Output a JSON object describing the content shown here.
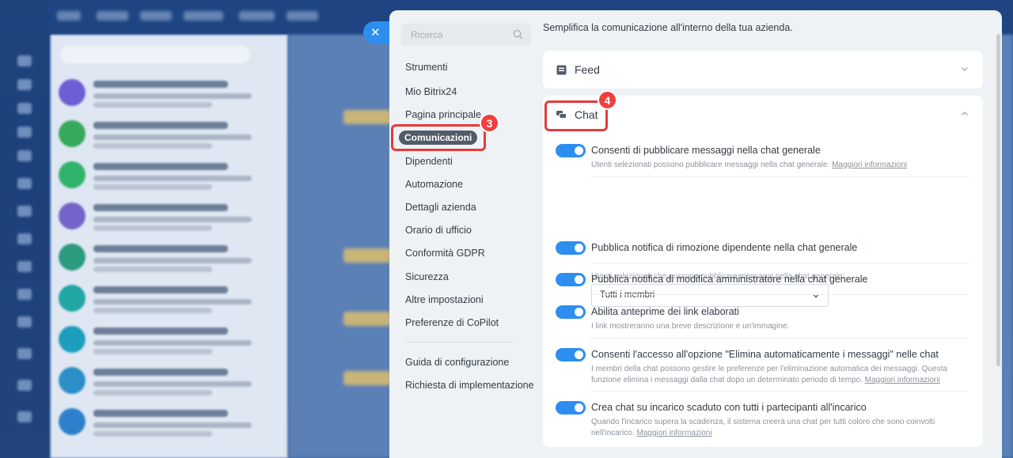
{
  "panel": {
    "search_placeholder": "Ricerca",
    "intro": "Semplifica la comunicazione all'interno della tua azienda."
  },
  "nav": {
    "items": [
      {
        "label": "Strumenti"
      },
      {
        "label": "Mio Bitrix24"
      },
      {
        "label": "Pagina principale"
      },
      {
        "label": "Comunicazioni",
        "active": true
      },
      {
        "label": "Dipendenti"
      },
      {
        "label": "Automazione"
      },
      {
        "label": "Dettagli azienda"
      },
      {
        "label": "Orario di ufficio"
      },
      {
        "label": "Conformità GDPR"
      },
      {
        "label": "Sicurezza"
      },
      {
        "label": "Altre impostazioni"
      },
      {
        "label": "Preferenze di CoPilot"
      }
    ],
    "footer": [
      {
        "label": "Guida di configurazione"
      },
      {
        "label": "Richiesta di implementazione"
      }
    ]
  },
  "badges": {
    "nav": "3",
    "chat": "4"
  },
  "sections": {
    "feed": {
      "title": "Feed",
      "expanded": false
    },
    "chat": {
      "title": "Chat",
      "expanded": true,
      "options": [
        {
          "title": "Consenti di pubblicare messaggi nella chat generale",
          "description": "Utenti selezionati possono pubblicare messaggi nella chat generale.",
          "link": "Maggiori informazioni",
          "enabled": true
        },
        {
          "title": "Pubblica notifica di rimozione dipendente nella chat generale",
          "enabled": true
        },
        {
          "title": "Pubblica notifica di modifica amministratore nella chat generale",
          "enabled": true
        },
        {
          "title": "Abilita anteprime dei link elaborati",
          "description": "I link mostreranno una breve descrizione e un'immagine.",
          "enabled": true
        },
        {
          "title": "Consenti l'accesso all'opzione \"Elimina automaticamente i messaggi\" nelle chat",
          "description": "I membri della chat possono gestire le preferenze per l'eliminazione automatica dei messaggi. Questa funzione elimina i messaggi dalla chat dopo un determinato periodo di tempo.",
          "link": "Maggiori informazioni",
          "enabled": true
        },
        {
          "title": "Crea chat su incarico scaduto con tutti i partecipanti all'incarico",
          "description": "Quando l'incarico supera la scadenza, il sistema creerà una chat per tutti coloro che sono coinvolti nell'incarico.",
          "link": "Maggiori informazioni",
          "enabled": true
        }
      ],
      "posting_selector": {
        "label": "Utenti selezionati che possono pubblicare messaggi nella chat generale:",
        "value": "Tutti i membri"
      }
    }
  },
  "colors": {
    "accent": "#2d8ef0",
    "highlight": "#e43b3b",
    "active_nav": "#525c69"
  }
}
